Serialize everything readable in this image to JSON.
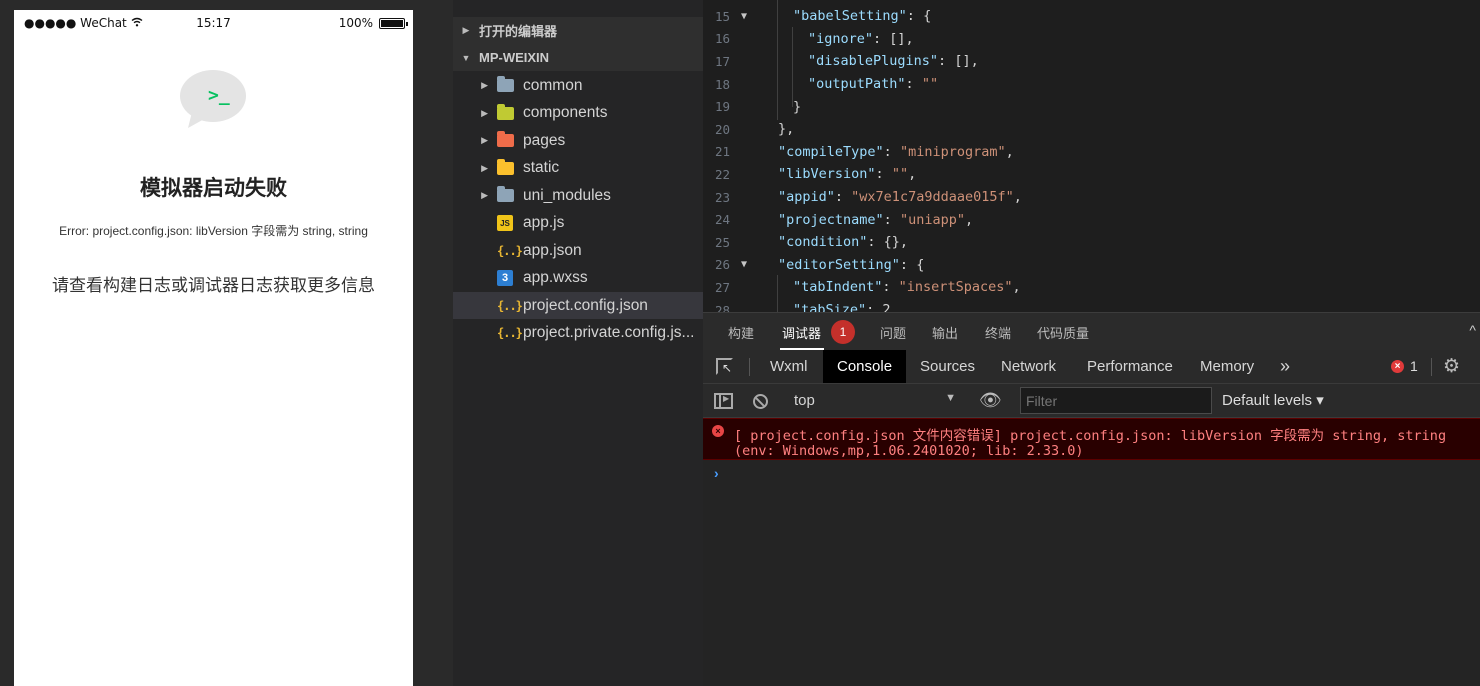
{
  "simulator": {
    "status": {
      "carrier": "●●●●● WeChat",
      "time": "15:17",
      "battery_text": "100%",
      "battery_level": 1.0
    },
    "bubble_glyph": ">_",
    "title": "模拟器启动失败",
    "error": "Error: project.config.json: libVersion 字段需为 string, string",
    "hint": "请查看构建日志或调试器日志获取更多信息"
  },
  "explorer": {
    "open_editors": "打开的编辑器",
    "project": "MP-WEIXIN",
    "items": [
      {
        "label": "common",
        "icon": "folder-icon",
        "color": "#8ea4b7"
      },
      {
        "label": "components",
        "icon": "components-folder-icon",
        "color": "#c0ca33"
      },
      {
        "label": "pages",
        "icon": "pages-folder-icon",
        "color": "#ef6c4a"
      },
      {
        "label": "static",
        "icon": "static-folder-icon",
        "color": "#fbc02d"
      },
      {
        "label": "uni_modules",
        "icon": "folder-icon",
        "color": "#8ea4b7"
      },
      {
        "label": "app.js",
        "icon": "js-file-icon",
        "badge": "JS"
      },
      {
        "label": "app.json",
        "icon": "json-file-icon",
        "badge": "{..}"
      },
      {
        "label": "app.wxss",
        "icon": "css-file-icon",
        "badge": "3"
      },
      {
        "label": "project.config.json",
        "icon": "json-file-icon",
        "badge": "{..}"
      },
      {
        "label": "project.private.config.js...",
        "icon": "json-file-icon",
        "badge": "{..}"
      }
    ]
  },
  "editor": {
    "line_numbers": [
      "15",
      "16",
      "17",
      "18",
      "19",
      "20",
      "21",
      "22",
      "23",
      "24",
      "25",
      "26",
      "27",
      "28"
    ],
    "lines": [
      {
        "key": "\"babelSetting\"",
        "sep": ": ",
        "val": "",
        "tail": "{"
      },
      {
        "key": "\"ignore\"",
        "sep": ": ",
        "val": "",
        "tail": "[],"
      },
      {
        "key": "\"disablePlugins\"",
        "sep": ": ",
        "val": "",
        "tail": "[],"
      },
      {
        "key": "\"outputPath\"",
        "sep": ": ",
        "val": "\"\"",
        "tail": ""
      },
      {
        "key": "",
        "sep": "",
        "val": "",
        "tail": "}"
      },
      {
        "key": "",
        "sep": "",
        "val": "",
        "tail": "},"
      },
      {
        "key": "\"compileType\"",
        "sep": ": ",
        "val": "\"miniprogram\"",
        "tail": ","
      },
      {
        "key": "\"libVersion\"",
        "sep": ": ",
        "val": "\"\"",
        "tail": ","
      },
      {
        "key": "\"appid\"",
        "sep": ": ",
        "val": "\"wx7e1c7a9ddaae015f\"",
        "tail": ","
      },
      {
        "key": "\"projectname\"",
        "sep": ": ",
        "val": "\"uniapp\"",
        "tail": ","
      },
      {
        "key": "\"condition\"",
        "sep": ": ",
        "val": "",
        "tail": "{},"
      },
      {
        "key": "\"editorSetting\"",
        "sep": ": ",
        "val": "",
        "tail": "{"
      },
      {
        "key": "\"tabIndent\"",
        "sep": ": ",
        "val": "\"insertSpaces\"",
        "tail": ","
      },
      {
        "key": "\"tabSize\"",
        "sep": ": ",
        "val": "",
        "tail": "2"
      }
    ]
  },
  "panel": {
    "tabs": [
      "构建",
      "调试器",
      "问题",
      "输出",
      "终端",
      "代码质量"
    ],
    "debugger_badge": "1",
    "collapse_glyph": "^",
    "devtools_tabs": [
      "Wxml",
      "Console",
      "Sources",
      "Network",
      "Performance",
      "Memory"
    ],
    "more_glyph": "»",
    "error_count": "1",
    "context": "top",
    "filter_placeholder": "Filter",
    "levels": "Default levels ▾",
    "message_line1": "[ project.config.json 文件内容错误] project.config.json: libVersion 字段需为 string, string",
    "message_line2": "(env: Windows,mp,1.06.2401020; lib: 2.33.0)",
    "prompt_glyph": "›"
  }
}
